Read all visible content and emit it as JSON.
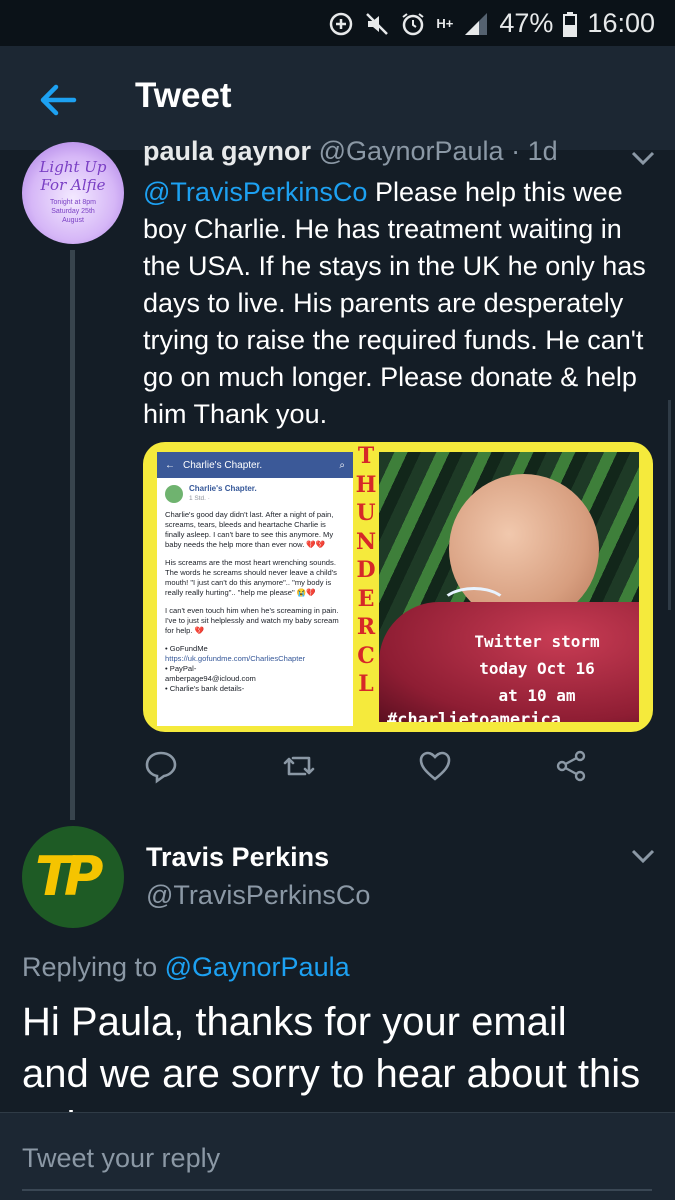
{
  "status_bar": {
    "battery": "47%",
    "time": "16:00",
    "network": "H+"
  },
  "header": {
    "title": "Tweet"
  },
  "tweet1": {
    "avatar": {
      "title_line1": "Light Up",
      "title_line2": "For Alfie",
      "subtitle_line1": "Tonight at 8pm",
      "subtitle_line2": "Saturday 25th",
      "subtitle_line3": "August"
    },
    "name": "paula gaynor",
    "handle": "@GaynorPaula",
    "separator": " · ",
    "time": "1d",
    "mention": "@TravisPerkinsCo",
    "text": " Please help this wee boy Charlie. He has treatment waiting in the USA. If he stays in the UK he only has days to live.  His parents are desperately trying to raise the required funds. He can't go on much longer.  Please donate & help him Thank you.",
    "media": {
      "fb_page": "Charlie's Chapter.",
      "fb_author": "Charlie's Chapter.",
      "fb_date": "1 Std. · ",
      "fb_p1": "Charlie's good day didn't last. After a night of pain, screams, tears, bleeds and heartache Charlie is finally asleep. I can't bare to see this anymore. My baby needs the help more than ever now. 💔💔",
      "fb_p2": "His screams are the most heart wrenching sounds. The words he screams should never leave a child's mouth! \"I just can't do this anymore\".. \"my body is really really hurting\".. \"help me please\" 😭💔",
      "fb_p3": "I can't even touch him when he's screaming in pain. I've to just sit helplessly and watch my baby scream for help. 💔",
      "fb_l1": "• GoFundMe",
      "fb_l2": "https://uk.gofundme.com/CharliesChapter",
      "fb_l3": "• PayPal-",
      "fb_l4": "amberpage94@icloud.com",
      "fb_l5": "• Charlie's bank details-",
      "vertical_word": "THUNDERCL",
      "storm_line1": "Twitter storm",
      "storm_line2": "today Oct 16",
      "storm_line3": "at 10 am",
      "hashtag": "#charlietoamerica"
    }
  },
  "tweet2": {
    "avatar_logo": "TP",
    "name": "Travis Perkins",
    "handle": "@TravisPerkinsCo",
    "replying_prefix": "Replying to ",
    "replying_to": "@GaynorPaula",
    "text": "Hi Paula, thanks for your email and we are sorry to hear about this to hear"
  },
  "reply_bar": {
    "placeholder": "Tweet your reply"
  },
  "icons": {
    "accent": "#1da1f2",
    "muted": "#8b98a5"
  }
}
